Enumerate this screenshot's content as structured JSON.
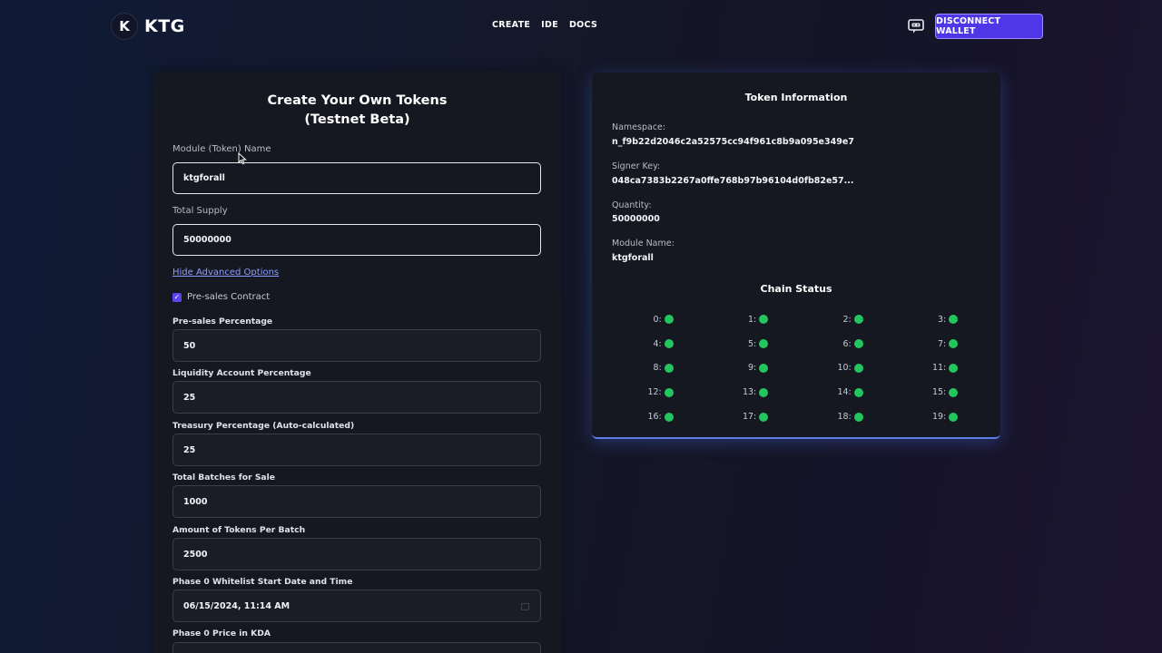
{
  "header": {
    "logo_letter": "K",
    "logo_text": "KTG",
    "nav": [
      "CREATE",
      "IDE",
      "DOCS"
    ],
    "disconnect_label": "DISCONNECT WALLET",
    "chat_icon": "robot-chat-icon"
  },
  "form": {
    "title_line1": "Create Your Own Tokens",
    "title_line2": "(Testnet Beta)",
    "module_name_label": "Module (Token) Name",
    "module_name_value": "ktgforall",
    "total_supply_label": "Total Supply",
    "total_supply_value": "50000000",
    "advanced_link": "Hide Advanced Options",
    "presales_contract_label": "Pre-sales Contract",
    "presales_contract_checked": true,
    "fields": [
      {
        "label": "Pre-sales Percentage",
        "value": "50"
      },
      {
        "label": "Liquidity Account Percentage",
        "value": "25"
      },
      {
        "label": "Treasury Percentage (Auto-calculated)",
        "value": "25"
      },
      {
        "label": "Total Batches for Sale",
        "value": "1000"
      },
      {
        "label": "Amount of Tokens Per Batch",
        "value": "2500"
      },
      {
        "label": "Phase 0 Whitelist Start Date and Time",
        "value": "06/15/2024, 11:14 AM"
      },
      {
        "label": "Phase 0 Price in KDA",
        "value": ""
      }
    ]
  },
  "info": {
    "title": "Token Information",
    "namespace_label": "Namespace:",
    "namespace_value": "n_f9b22d2046c2a52575cc94f961c8b9a095e349e7",
    "signer_label": "Signer Key:",
    "signer_value": "048ca7383b2267a0ffe768b97b96104d0fb82e57...",
    "quantity_label": "Quantity:",
    "quantity_value": "50000000",
    "module_label": "Module Name:",
    "module_value": "ktgforall",
    "chain_title": "Chain Status",
    "chain_status_color": "#22c55e",
    "chains": [
      "0:",
      "1:",
      "2:",
      "3:",
      "4:",
      "5:",
      "6:",
      "7:",
      "8:",
      "9:",
      "10:",
      "11:",
      "12:",
      "13:",
      "14:",
      "15:",
      "16:",
      "17:",
      "18:",
      "19:"
    ]
  },
  "colors": {
    "accent": "#4f36e6",
    "link": "#8f9dff",
    "status_ok": "#22c55e"
  }
}
